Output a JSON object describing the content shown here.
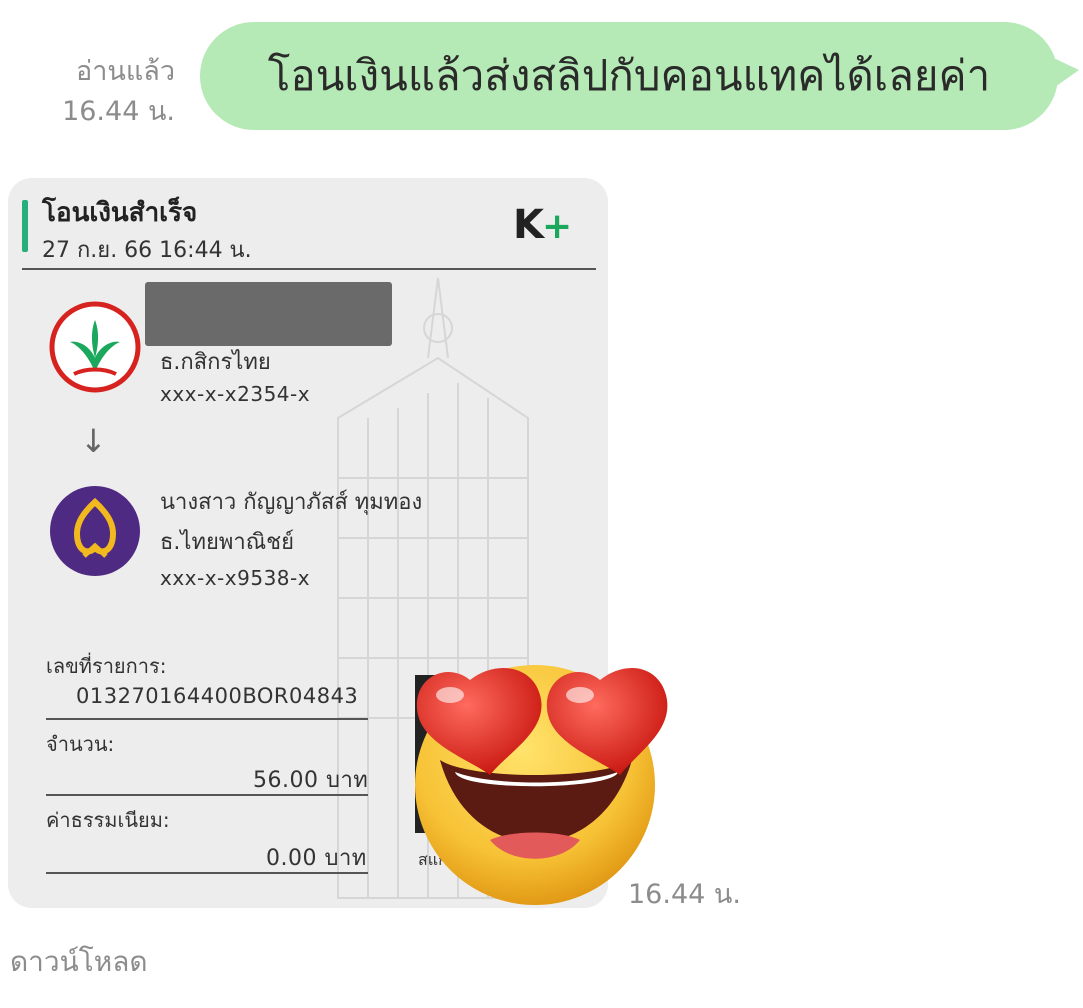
{
  "outgoing": {
    "read_status": "อ่านแล้ว",
    "time": "16.44 น.",
    "message": "โอนเงินแล้วส่งสลิปกับคอนแทคได้เลยค่า"
  },
  "slip": {
    "title": "โอนเงินสำเร็จ",
    "date": "27 ก.ย. 66  16:44 น.",
    "app_logo": "K",
    "app_logo_plus": "+",
    "sender": {
      "bank": "ธ.กสิกรไทย",
      "account": "xxx-x-x2354-x",
      "logo_icon": "kasikorn-bank-icon",
      "logo_color": "#1ba85c"
    },
    "receiver": {
      "name": "นางสาว กัญญาภัสส์ ทุมทอง",
      "bank": "ธ.ไทยพาณิชย์",
      "account": "xxx-x-x9538-x",
      "logo_icon": "scb-bank-icon",
      "logo_color": "#4f2a82"
    },
    "ref_label": "เลขที่รายการ:",
    "ref_value": "013270164400BOR04843",
    "amount_label": "จำนวน:",
    "amount_value": "56.00 บาท",
    "fee_label": "ค่าธรรมเนียม:",
    "fee_value": "0.00 บาท",
    "qr_label": "สแกน",
    "accent_color": "#27ae7a"
  },
  "incoming": {
    "time": "16.44 น.",
    "sticker": "heart-eyes-emoji"
  },
  "download_label": "ดาวน์โหลด"
}
